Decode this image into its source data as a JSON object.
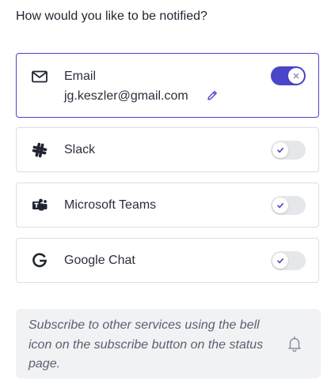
{
  "heading": "How would you like to be notified?",
  "channels": [
    {
      "label": "Email",
      "value": "jg.keszler@gmail.com",
      "icon": "envelope-icon",
      "enabled": true
    },
    {
      "label": "Slack",
      "icon": "slack-icon",
      "enabled": false
    },
    {
      "label": "Microsoft Teams",
      "icon": "microsoft-teams-icon",
      "enabled": false
    },
    {
      "label": "Google Chat",
      "icon": "google-icon",
      "enabled": false
    }
  ],
  "info": {
    "text": "Subscribe to other services using the bell icon on the subscribe button on the status page.",
    "icon": "bell-icon"
  },
  "colors": {
    "accent": "#4b45c9",
    "toggle_off": "#e6e7eb",
    "info_background": "#f1f2f4"
  }
}
